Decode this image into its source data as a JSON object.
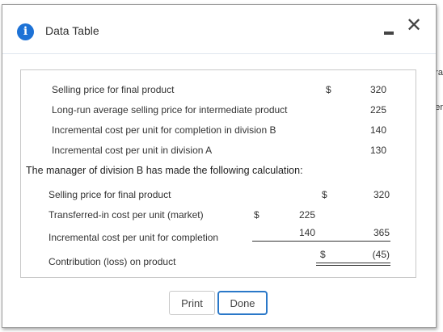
{
  "background": {
    "peek_1": "tra",
    "peek_2": "er"
  },
  "dialog": {
    "title": "Data Table",
    "info_icon_glyph": "i",
    "minimize_glyph": "",
    "close_glyph": "✕"
  },
  "table1": {
    "rows": [
      {
        "label": "Selling price for final product",
        "dollar": "$",
        "value": "320"
      },
      {
        "label": "Long-run average selling price for intermediate product",
        "dollar": "",
        "value": "225"
      },
      {
        "label": "Incremental cost per unit for completion in division B",
        "dollar": "",
        "value": "140"
      },
      {
        "label": "Incremental cost per unit in division A",
        "dollar": "",
        "value": "130"
      }
    ]
  },
  "note": "The manager of division B has made the following calculation:",
  "table2": {
    "selling_price": {
      "label": "Selling price for final product",
      "dollar": "$",
      "value": "320"
    },
    "transferred_in": {
      "label": "Transferred-in cost per unit (market)",
      "dollar": "$",
      "value": "225"
    },
    "incremental": {
      "label": "Incremental cost per unit for completion",
      "value_mid": "140",
      "value": "365"
    },
    "contribution": {
      "label": "Contribution (loss) on product",
      "dollar": "$",
      "value": "(45)"
    }
  },
  "buttons": {
    "print": "Print",
    "done": "Done"
  }
}
